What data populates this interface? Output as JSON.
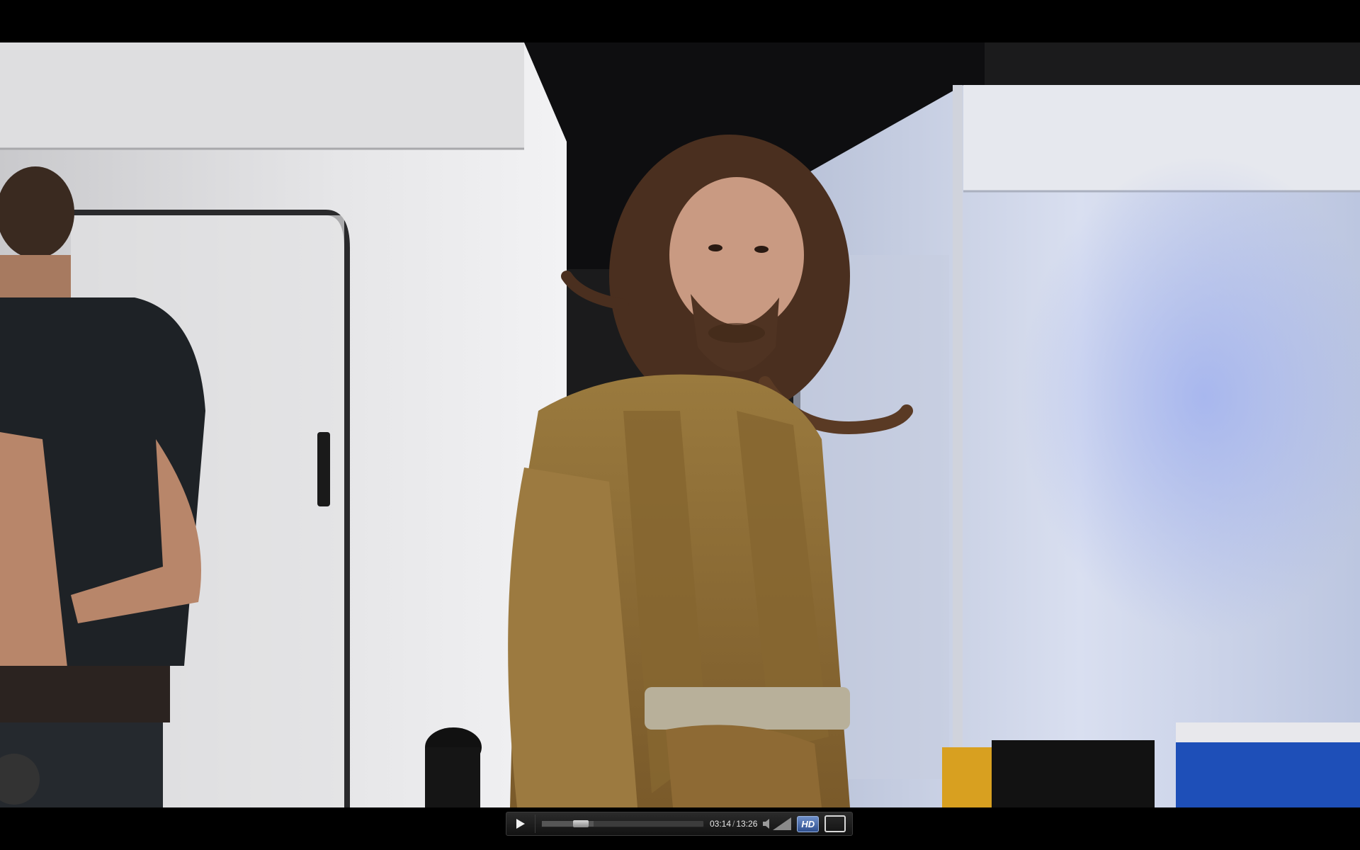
{
  "player": {
    "current_time": "03:14",
    "separator": "/",
    "duration": "13:26",
    "progress_fraction": 0.24,
    "loaded_fraction": 0.32,
    "volume_muted": true,
    "hd_label": "HD",
    "hd_active": true
  },
  "colors": {
    "hd_accent": "#4a6fb0",
    "control_bg": "#1e1e1e"
  },
  "icons": {
    "play": "play-icon",
    "volume": "speaker-icon",
    "fullscreen": "fullscreen-icon"
  }
}
